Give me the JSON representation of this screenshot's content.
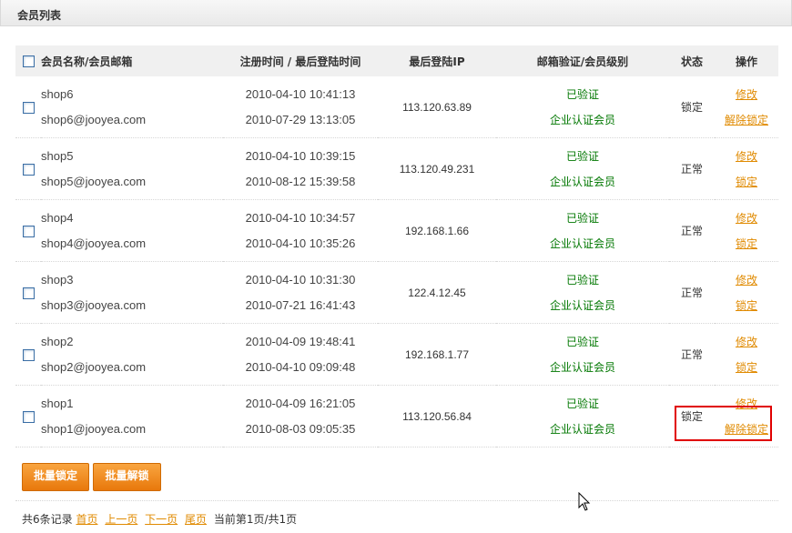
{
  "panel": {
    "title": "会员列表"
  },
  "table": {
    "headers": {
      "name": "会员名称/会员邮箱",
      "time": "注册时间 / 最后登陆时间",
      "ip": "最后登陆IP",
      "verify": "邮箱验证/会员级别",
      "status": "状态",
      "action": "操作"
    },
    "rows": [
      {
        "name": "shop6",
        "email": "shop6@jooyea.com",
        "reg_time": "2010-04-10 10:41:13",
        "last_login": "2010-07-29 13:13:05",
        "ip": "113.120.63.89",
        "verify": "已验证",
        "level": "企业认证会员",
        "status": "锁定",
        "action1": "修改",
        "action2": "解除锁定"
      },
      {
        "name": "shop5",
        "email": "shop5@jooyea.com",
        "reg_time": "2010-04-10 10:39:15",
        "last_login": "2010-08-12 15:39:58",
        "ip": "113.120.49.231",
        "verify": "已验证",
        "level": "企业认证会员",
        "status": "正常",
        "action1": "修改",
        "action2": "锁定"
      },
      {
        "name": "shop4",
        "email": "shop4@jooyea.com",
        "reg_time": "2010-04-10 10:34:57",
        "last_login": "2010-04-10 10:35:26",
        "ip": "192.168.1.66",
        "verify": "已验证",
        "level": "企业认证会员",
        "status": "正常",
        "action1": "修改",
        "action2": "锁定"
      },
      {
        "name": "shop3",
        "email": "shop3@jooyea.com",
        "reg_time": "2010-04-10 10:31:30",
        "last_login": "2010-07-21 16:41:43",
        "ip": "122.4.12.45",
        "verify": "已验证",
        "level": "企业认证会员",
        "status": "正常",
        "action1": "修改",
        "action2": "锁定"
      },
      {
        "name": "shop2",
        "email": "shop2@jooyea.com",
        "reg_time": "2010-04-09 19:48:41",
        "last_login": "2010-04-10 09:09:48",
        "ip": "192.168.1.77",
        "verify": "已验证",
        "level": "企业认证会员",
        "status": "正常",
        "action1": "修改",
        "action2": "锁定"
      },
      {
        "name": "shop1",
        "email": "shop1@jooyea.com",
        "reg_time": "2010-04-09 16:21:05",
        "last_login": "2010-08-03 09:05:35",
        "ip": "113.120.56.84",
        "verify": "已验证",
        "level": "企业认证会员",
        "status": "锁定",
        "action1": "修改",
        "action2": "解除锁定"
      }
    ]
  },
  "batch": {
    "lock_label": "批量锁定",
    "unlock_label": "批量解锁"
  },
  "pagination": {
    "total": "共6条记录",
    "first": "首页",
    "prev": "上一页",
    "next": "下一页",
    "last": "尾页",
    "current": "当前第1页/共1页"
  },
  "colors": {
    "accent": "#e08a00",
    "locked": "#cc0000",
    "normal": "#007700",
    "highlight": "#e00000"
  },
  "icons": {
    "cursor": "mouse-pointer-icon"
  }
}
